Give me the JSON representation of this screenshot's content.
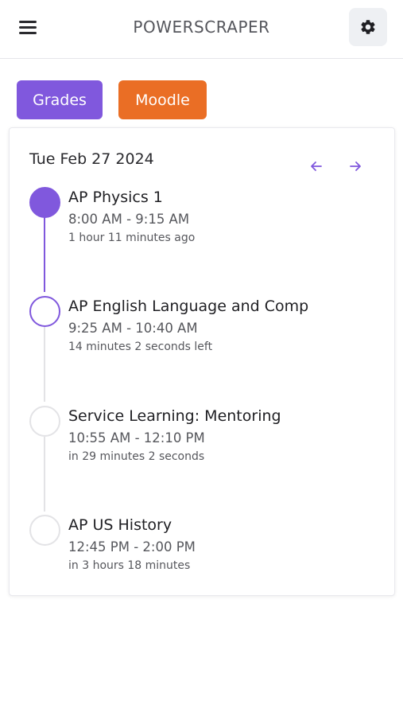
{
  "header": {
    "title": "POWERSCRAPER",
    "menu_icon": "hamburger-menu-icon",
    "settings_icon": "gear-icon"
  },
  "actions": {
    "grades_label": "Grades",
    "moodle_label": "Moodle"
  },
  "schedule": {
    "date": "Tue Feb 27 2024",
    "prev_icon": "arrow-left-icon",
    "next_icon": "arrow-right-icon",
    "events": [
      {
        "name": "AP Physics 1",
        "time": "8:00 AM - 9:15 AM",
        "relative": "1 hour 11 minutes ago",
        "status": "done"
      },
      {
        "name": "AP English Language and Comp",
        "time": "9:25 AM - 10:40 AM",
        "relative": "14 minutes 2 seconds left",
        "status": "active"
      },
      {
        "name": "Service Learning: Mentoring",
        "time": "10:55 AM - 12:10 PM",
        "relative": "in 29 minutes 2 seconds",
        "status": "upcoming"
      },
      {
        "name": "AP US History",
        "time": "12:45 PM - 2:00 PM",
        "relative": "in 3 hours 18 minutes",
        "status": "upcoming"
      }
    ]
  },
  "colors": {
    "accent_purple": "#8058dd",
    "moodle_orange": "#ea6e25",
    "timeline_inactive": "#e3e3e6"
  }
}
